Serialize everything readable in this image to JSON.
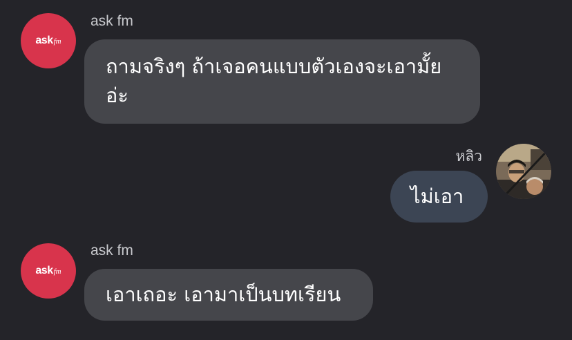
{
  "messages": [
    {
      "sender": "ask fm",
      "avatar_text_main": "ask",
      "avatar_text_sub": "fm",
      "text": "ถามจริงๆ ถ้าเจอคนแบบตัวเองจะเอามั้ยอ่ะ"
    },
    {
      "sender": "หลิว",
      "text": "ไม่เอา"
    },
    {
      "sender": "ask fm",
      "avatar_text_main": "ask",
      "avatar_text_sub": "fm",
      "text": "เอาเถอะ เอามาเป็นบทเรียน"
    }
  ],
  "colors": {
    "background": "#242429",
    "incoming_bubble": "#45464b",
    "outgoing_bubble": "#3c4554",
    "askfm_brand": "#d8344c"
  }
}
